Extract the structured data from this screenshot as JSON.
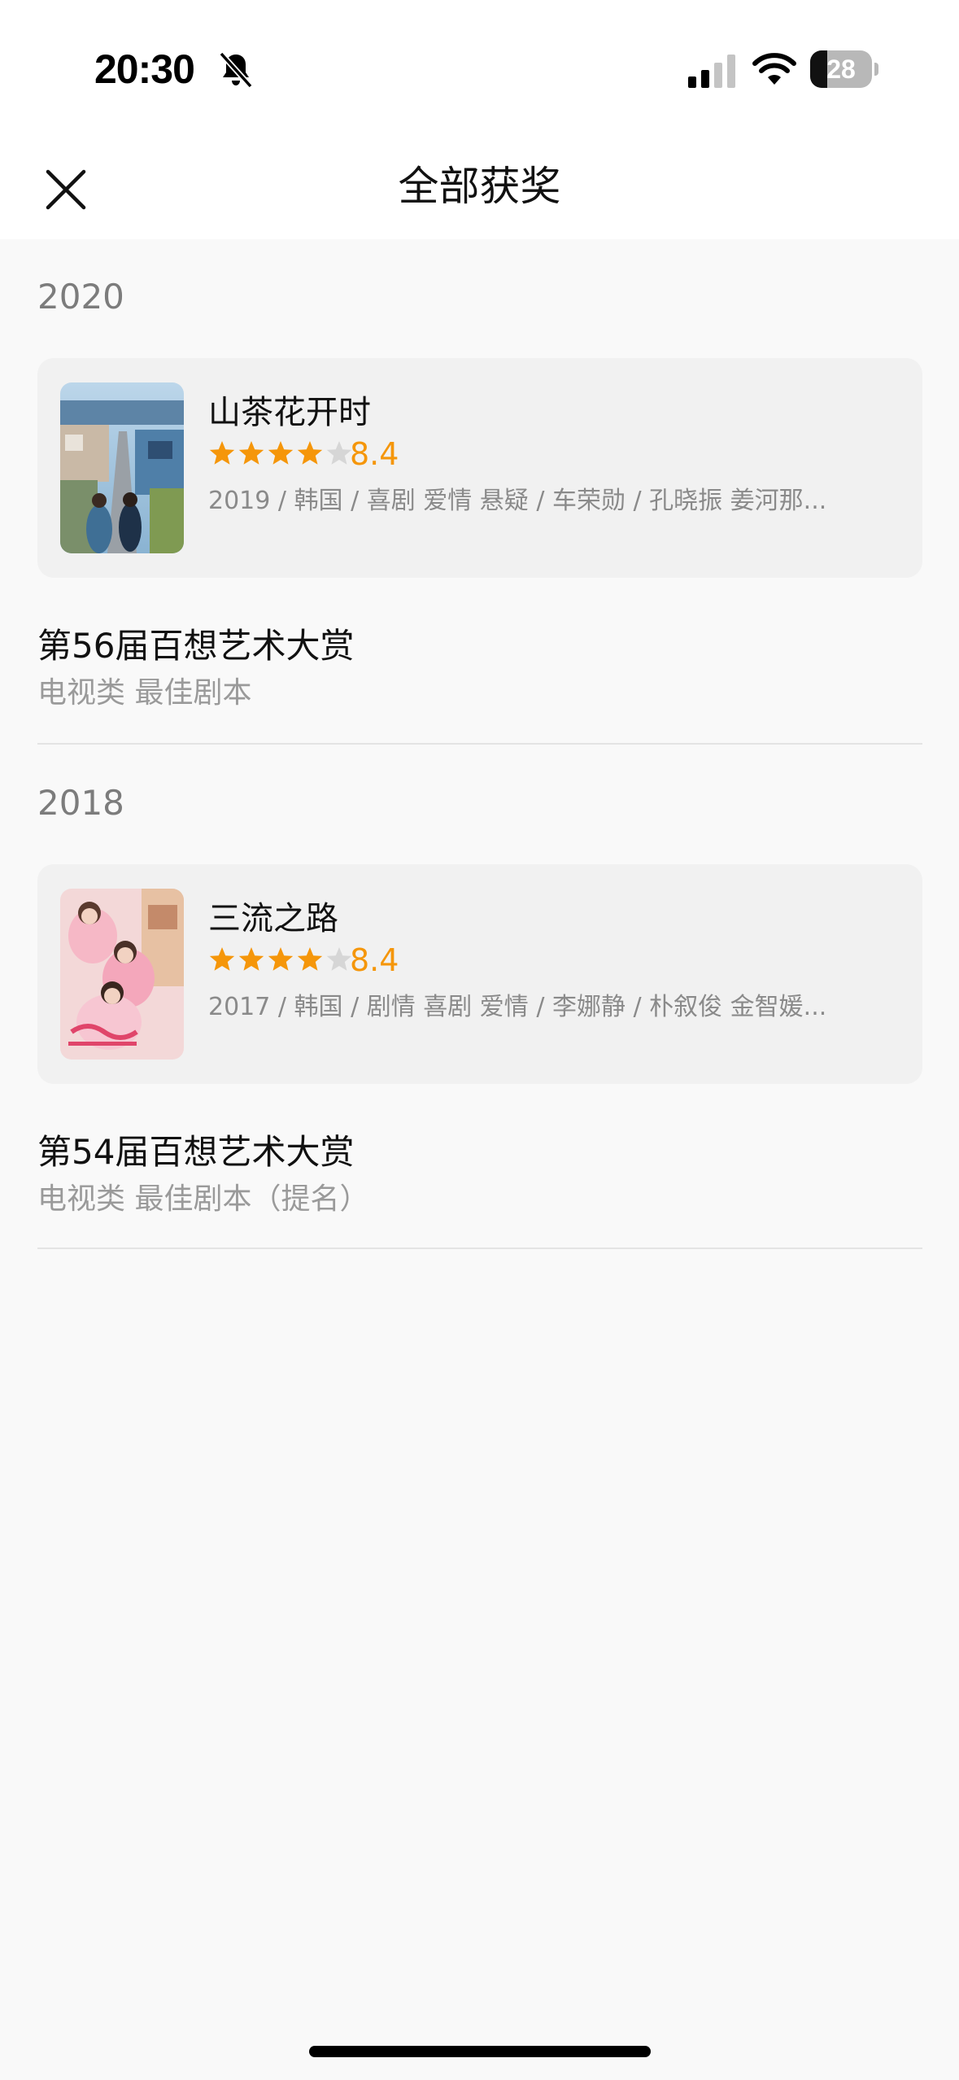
{
  "status_bar": {
    "time": "20:30",
    "battery_percent": 28,
    "battery_label": "28"
  },
  "nav": {
    "title": "全部获奖",
    "close_icon": "close-icon"
  },
  "colors": {
    "accent": "#f5960a",
    "star_empty": "#d6d6d6"
  },
  "awards": [
    {
      "year": "2020",
      "work": {
        "title": "山茶花开时",
        "stars": 4,
        "score": "8.4",
        "meta": "2019 / 韩国 / 喜剧 爱情 悬疑 / 车荣勋 / 孔晓振 姜河那..."
      },
      "award_name": "第56届百想艺术大赏",
      "category": "电视类 最佳剧本"
    },
    {
      "year": "2018",
      "work": {
        "title": "三流之路",
        "stars": 4,
        "score": "8.4",
        "meta": "2017 / 韩国 / 剧情 喜剧 爱情 / 李娜静 / 朴叙俊 金智媛..."
      },
      "award_name": "第54届百想艺术大赏",
      "category": "电视类 最佳剧本（提名）"
    }
  ]
}
